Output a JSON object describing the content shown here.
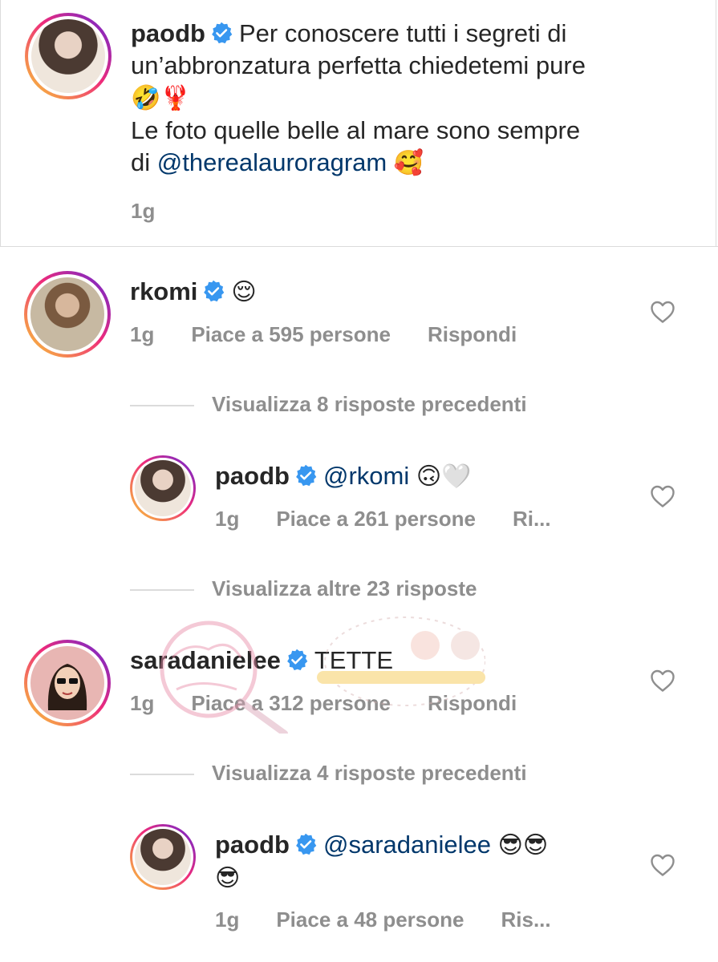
{
  "caption": {
    "username": "paodb",
    "text_line1": "Per conoscere tutti i segreti di",
    "text_line2": "un’abbronzatura perfetta chiedetemi pure",
    "emojis_line3": "🤣🦞",
    "text_line4": "Le foto quelle belle al mare sono sempre",
    "text_line5_prefix": "di ",
    "mention": "@therealauroragram",
    "emoji_end": "🥰",
    "time": "1g"
  },
  "comments": [
    {
      "username": "rkomi",
      "emoji": "😌",
      "time": "1g",
      "likes": "Piace a 595 persone",
      "reply": "Rispondi"
    },
    {
      "username": "paodb",
      "mention": "@rkomi",
      "emoji": "🙃🤍",
      "time": "1g",
      "likes": "Piace a 261 persone",
      "reply": "Ri..."
    },
    {
      "username": "saradanielee",
      "text": "TETTE",
      "time": "1g",
      "likes": "Piace a 312 persone",
      "reply": "Rispondi"
    },
    {
      "username": "paodb",
      "mention": "@saradanielee",
      "emoji": "😎😎",
      "emoji_line2": "😎",
      "time": "1g",
      "likes": "Piace a 48 persone",
      "reply": "Ris..."
    }
  ],
  "view_replies": [
    "Visualizza 8 risposte precedenti",
    "Visualizza altre 23 risposte",
    "Visualizza 4 risposte precedenti"
  ],
  "colors": {
    "verified": "#3897f0",
    "mention": "#00376b",
    "meta": "#8e8e8e"
  },
  "icons": {
    "verified": "verified-badge-icon",
    "heart": "heart-outline-icon"
  }
}
